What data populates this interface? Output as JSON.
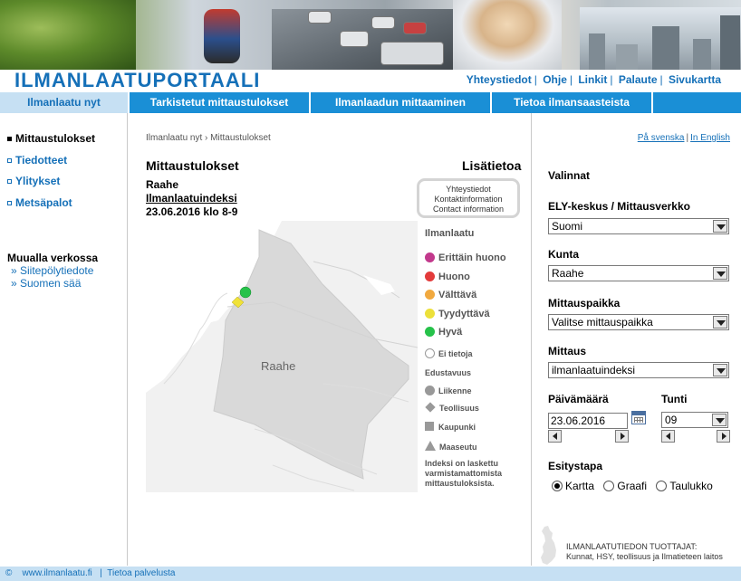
{
  "site": {
    "title": "ILMANLAATUPORTAALI"
  },
  "top_links": [
    "Yhteystiedot",
    "Ohje",
    "Linkit",
    "Palaute",
    "Sivukartta"
  ],
  "nav": [
    "Ilmanlaatu nyt",
    "Tarkistetut mittaustulokset",
    "Ilmanlaadun mittaaminen",
    "Tietoa ilmansaasteista",
    ""
  ],
  "sidebar": {
    "items": [
      "Mittaustulokset",
      "Tiedotteet",
      "Ylitykset",
      "Metsäpalot"
    ],
    "section_title": "Muualla verkossa",
    "links": [
      "» Siitepölytiedote",
      "» Suomen sää"
    ]
  },
  "breadcrumb": "Ilmanlaatu nyt › Mittaustulokset",
  "lang": {
    "sv": "På svenska",
    "en": "In English"
  },
  "main": {
    "title": "Mittaustulokset",
    "more_title": "Lisätietoa",
    "location": "Raahe",
    "index_link": "Ilmanlaatuindeksi",
    "datetime": "23.06.2016 klo 8-9",
    "contact_box": [
      "Yhteystiedot",
      "Kontaktinformation",
      "Contact information"
    ]
  },
  "map": {
    "label": "Raahe"
  },
  "legend": {
    "title": "Ilmanlaatu",
    "levels": [
      {
        "label": "Erittäin huono",
        "color": "#c2398c"
      },
      {
        "label": "Huono",
        "color": "#e33b3b"
      },
      {
        "label": "Välttävä",
        "color": "#f1a93f"
      },
      {
        "label": "Tyydyttävä",
        "color": "#ece03a"
      },
      {
        "label": "Hyvä",
        "color": "#26c24a"
      }
    ],
    "no_data": "Ei tietoja",
    "repr_title": "Edustavuus",
    "repr": [
      "Liikenne",
      "Teollisuus",
      "Kaupunki",
      "Maaseutu"
    ],
    "note": "Indeksi on laskettu varmistamattomista mittaustuloksista."
  },
  "panel": {
    "title": "Valinnat",
    "ely_label": "ELY-keskus / Mittausverkko",
    "ely_value": "Suomi",
    "kunta_label": "Kunta",
    "kunta_value": "Raahe",
    "paikka_label": "Mittauspaikka",
    "paikka_value": "Valitse mittauspaikka",
    "mittaus_label": "Mittaus",
    "mittaus_value": "ilmanlaatuindeksi",
    "date_label": "Päivämäärä",
    "date_value": "23.06.2016",
    "time_label": "Tunti",
    "time_value": "09",
    "style_label": "Esitystapa",
    "style_options": [
      "Kartta",
      "Graafi",
      "Taulukko"
    ],
    "producers_title": "ILMANLAATUTIEDON TUOTTAJAT:",
    "producers_text": "Kunnat, HSY, teollisuus ja Ilmatieteen laitos"
  },
  "footer": {
    "copyright": "©",
    "site": "www.ilmanlaatu.fi",
    "about": "Tietoa palvelusta"
  }
}
